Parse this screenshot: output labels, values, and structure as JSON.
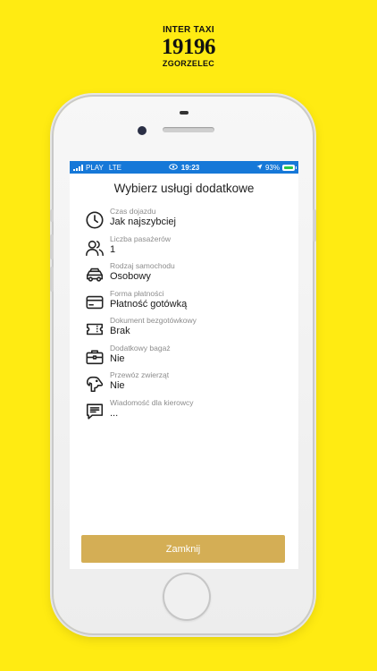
{
  "brand": {
    "line1": "INTER TAXI",
    "line2": "19196",
    "line3": "ZGORZELEC"
  },
  "status": {
    "carrier": "PLAY",
    "network": "LTE",
    "time": "19:23",
    "battery": "93%"
  },
  "sheet": {
    "title": "Wybierz usługi dodatkowe",
    "options": [
      {
        "label": "Czas dojazdu",
        "value": "Jak najszybciej",
        "icon": "clock-icon"
      },
      {
        "label": "Liczba pasażerów",
        "value": "1",
        "icon": "passengers-icon"
      },
      {
        "label": "Rodzaj samochodu",
        "value": "Osobowy",
        "icon": "car-icon"
      },
      {
        "label": "Forma płatności",
        "value": "Płatność gotówką",
        "icon": "credit-card-icon"
      },
      {
        "label": "Dokument bezgotówkowy",
        "value": "Brak",
        "icon": "ticket-icon"
      },
      {
        "label": "Dodatkowy bagaż",
        "value": "Nie",
        "icon": "briefcase-icon"
      },
      {
        "label": "Przewóz zwierząt",
        "value": "Nie",
        "icon": "dog-icon"
      },
      {
        "label": "Wiadomość dla kierowcy",
        "value": "...",
        "icon": "message-icon"
      }
    ],
    "close_label": "Zamknij"
  },
  "colors": {
    "background": "#FFEB12",
    "status_bar": "#1678D8",
    "button": "#D4AE55"
  }
}
